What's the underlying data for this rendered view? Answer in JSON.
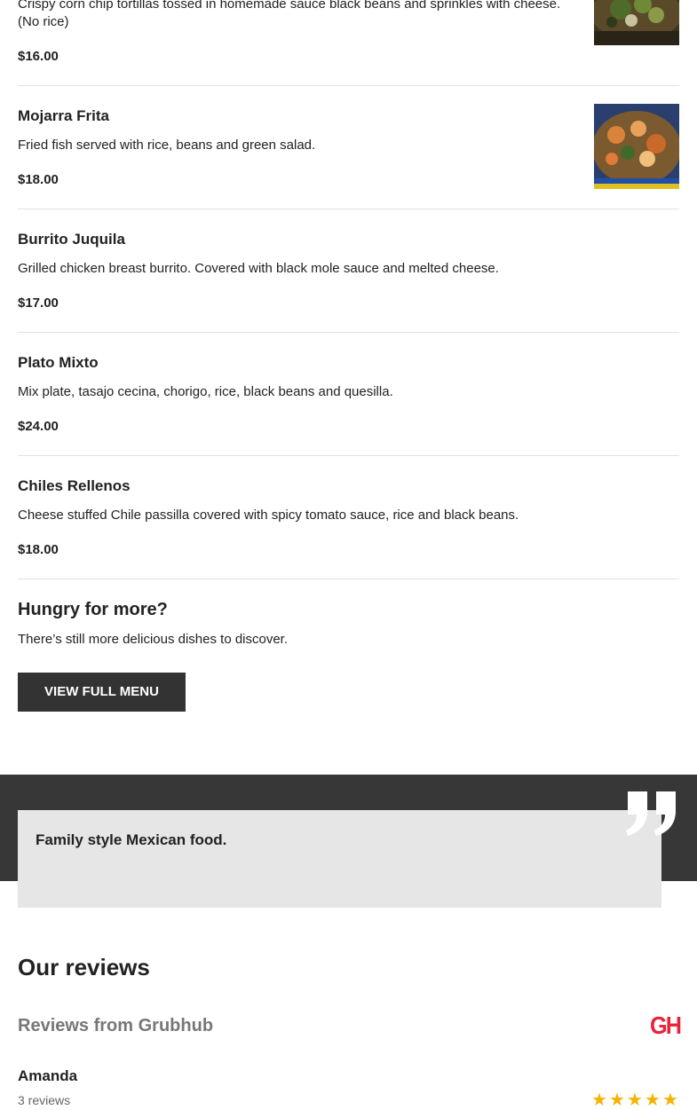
{
  "menu_items": [
    {
      "name": "",
      "description": "Crispy corn chip tortillas tossed in homemade sauce black beans and sprinkles with cheese. (No rice)",
      "price": "$16.00",
      "photo": "chilaquiles-photo"
    },
    {
      "name": "Mojarra Frita",
      "description": "Fried fish served with rice, beans and green salad.",
      "price": "$18.00",
      "photo": "mojarra-frita-photo"
    },
    {
      "name": "Burrito Juquila",
      "description": "Grilled chicken breast burrito. Covered with black mole sauce and melted cheese.",
      "price": "$17.00"
    },
    {
      "name": "Plato Mixto",
      "description": "Mix plate, tasajo cecina, chorigo, rice, black beans and quesilla.",
      "price": "$24.00"
    },
    {
      "name": "Chiles Rellenos",
      "description": "Cheese stuffed Chile passilla covered with spicy tomato sauce, rice and black beans.",
      "price": "$18.00"
    }
  ],
  "cta": {
    "title": "Hungry for more?",
    "text": "There’s still more delicious dishes to discover.",
    "button_label": "VIEW FULL MENU"
  },
  "quote": {
    "text": "Family style Mexican food.",
    "icon": "quote-mark-icon"
  },
  "reviews": {
    "title": "Our reviews",
    "source_label": "Reviews from Grubhub",
    "source_logo_text": "GH",
    "reviewer": {
      "name": "Amanda",
      "count": "3 reviews",
      "rating": 5,
      "rating_max": 5
    }
  },
  "colors": {
    "button_bg": "#333333",
    "quote_band": "#373737",
    "quote_card": "#e6e6e6",
    "grubhub_red": "#e8243b",
    "star": "#f5b301"
  }
}
